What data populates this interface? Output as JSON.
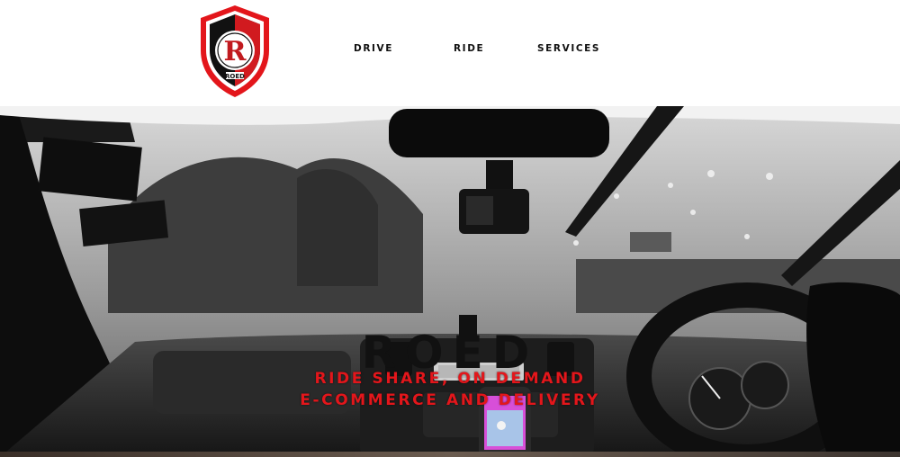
{
  "brand": {
    "logo_text": "ROED",
    "logo_letter": "R"
  },
  "nav": {
    "items": [
      {
        "label": "DRIVE"
      },
      {
        "label": "RIDE"
      },
      {
        "label": "SERVICES"
      }
    ]
  },
  "hero": {
    "title": "ROED",
    "tagline_line1": "RIDE SHARE, ON DEMAND",
    "tagline_line2": "E-COMMERCE AND DELIVERY"
  },
  "colors": {
    "accent": "#e3161b",
    "text": "#111111",
    "background": "#ffffff"
  }
}
